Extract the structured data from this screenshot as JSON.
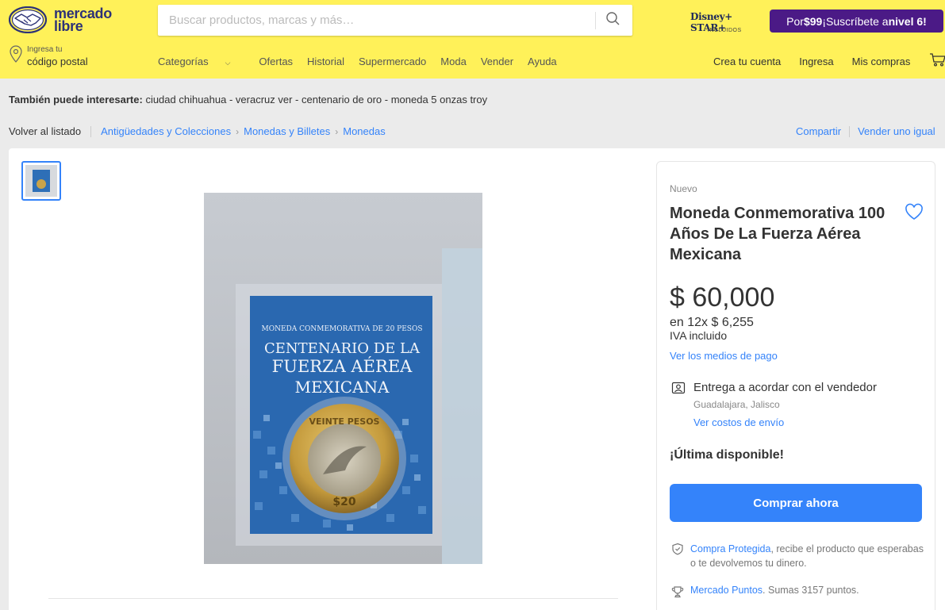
{
  "header": {
    "logo_line1": "mercado",
    "logo_line2": "libre",
    "search_placeholder": "Buscar productos, marcas y más…",
    "disney_brand": "Disney+ STAR+",
    "disney_sub": "INCLUIDOS",
    "promo_prefix": "Por ",
    "promo_price": "$99",
    "promo_mid": " ¡Suscríbete a ",
    "promo_level": "nivel 6",
    "promo_suffix": "!",
    "location_line1": "Ingresa tu",
    "location_line2": "código postal",
    "nav": [
      "Categorías",
      "Ofertas",
      "Historial",
      "Supermercado",
      "Moda",
      "Vender",
      "Ayuda"
    ],
    "user_nav": [
      "Crea tu cuenta",
      "Ingresa",
      "Mis compras"
    ],
    "colors": {
      "brand_yellow": "#fff159",
      "promo_purple": "#4b1a86",
      "link_blue": "#3483fa"
    }
  },
  "related": {
    "label": "También puede interesarte:",
    "items": "ciudad chihuahua - veracruz ver - centenario de oro - moneda 5 onzas troy"
  },
  "breadcrumb": {
    "back": "Volver al listado",
    "items": [
      "Antigüedades y Colecciones",
      "Monedas y Billetes",
      "Monedas"
    ],
    "share": "Compartir",
    "sell": "Vender uno igual"
  },
  "product": {
    "package_text_1": "MONEDA CONMEMORATIVA DE 20 PESOS",
    "package_text_2": "CENTENARIO DE LA",
    "package_text_3": "FUERZA AÉREA",
    "package_text_4": "MEXICANA",
    "coin_text": "VEINTE PESOS",
    "coin_value": "$20"
  },
  "buybox": {
    "condition": "Nuevo",
    "title": "Moneda Conmemorativa 100 Años De La Fuerza Aérea Mexicana",
    "price": "$ 60,000",
    "installments": "en 12x $ 6,255",
    "tax": "IVA incluido",
    "payment_link": "Ver los medios de pago",
    "delivery": "Entrega a acordar con el vendedor",
    "location": "Guadalajara, Jalisco",
    "shipping_link": "Ver costos de envío",
    "stock": "¡Última disponible!",
    "buy_button": "Comprar ahora",
    "protection_link": "Compra Protegida",
    "protection_text": ", recibe el producto que esperabas o te devolvemos tu dinero.",
    "points_link": "Mercado Puntos",
    "points_text": ". Sumas 3157 puntos."
  }
}
